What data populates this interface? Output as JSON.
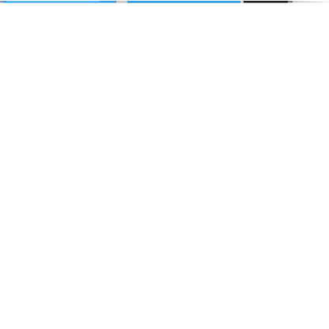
{
  "object": {
    "type": "slender-rod-shaft",
    "orientation": "horizontal"
  },
  "colors": {
    "background": "#ffffff",
    "shaft_blue": "#2ea3e8",
    "shaft_blue_light": "#8fd0f4",
    "shaft_blue_dark": "#1e86c6",
    "ferrule_silver": "#c9c9c9",
    "ferrule_silver_dark": "#8a8a8a",
    "grip_black": "#111111",
    "tip_grey": "#b0b0b0",
    "tip_dark": "#555555"
  }
}
